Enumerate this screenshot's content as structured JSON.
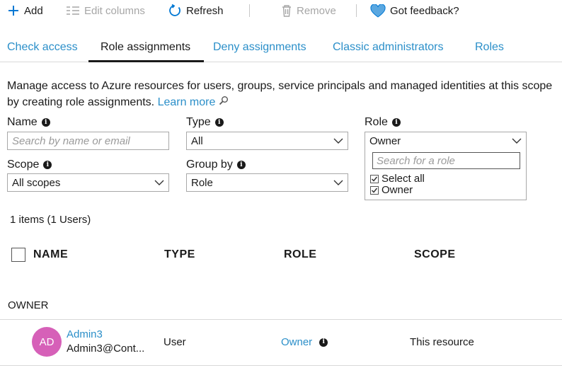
{
  "toolbar": {
    "add_label": "Add",
    "edit_columns_label": "Edit columns",
    "refresh_label": "Refresh",
    "remove_label": "Remove",
    "feedback_label": "Got feedback?"
  },
  "tabs": [
    {
      "label": "Check access"
    },
    {
      "label": "Role assignments"
    },
    {
      "label": "Deny assignments"
    },
    {
      "label": "Classic administrators"
    },
    {
      "label": "Roles"
    }
  ],
  "active_tab": "Role assignments",
  "description": {
    "text": "Manage access to Azure resources for users, groups, service principals and managed identities at this scope by creating role assignments.",
    "learn_more": "Learn more"
  },
  "filters": {
    "name": {
      "label": "Name",
      "placeholder": "Search by name or email"
    },
    "type": {
      "label": "Type",
      "value": "All"
    },
    "role": {
      "label": "Role",
      "value": "Owner",
      "search_placeholder": "Search for a role",
      "options": [
        {
          "label": "Select all",
          "checked": true
        },
        {
          "label": "Owner",
          "checked": true
        }
      ]
    },
    "scope": {
      "label": "Scope",
      "value": "All scopes"
    },
    "group_by": {
      "label": "Group by",
      "value": "Role"
    }
  },
  "count_text": "1 items (1 Users)",
  "table": {
    "headers": [
      "NAME",
      "TYPE",
      "ROLE",
      "SCOPE"
    ],
    "groups": [
      {
        "label": "OWNER",
        "rows": [
          {
            "initials": "AD",
            "name": "Admin3",
            "email": "Admin3@Cont...",
            "type": "User",
            "role": "Owner",
            "scope": "This resource"
          }
        ]
      }
    ]
  },
  "colors": {
    "link": "#2b8fc9",
    "accent": "#0078d4",
    "avatar": "#d660b8",
    "disabled": "#a6a6a6"
  }
}
